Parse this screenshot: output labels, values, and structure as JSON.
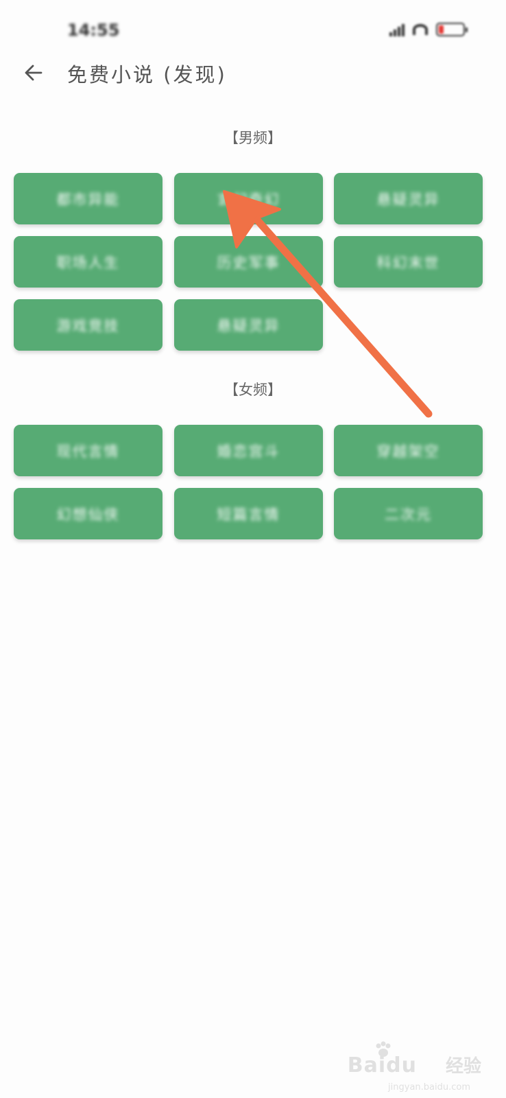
{
  "status_bar": {
    "time": "14:55",
    "icons": [
      "signal-icon",
      "wifi-icon",
      "battery-icon"
    ],
    "battery_color": "#e53935"
  },
  "header": {
    "back_icon": "arrow-left-icon",
    "title": "免费小说 (发现)"
  },
  "sections": [
    {
      "title": "【男频】",
      "categories": [
        {
          "label": "都市异能"
        },
        {
          "label": "玄幻奇幻"
        },
        {
          "label": "悬疑灵异"
        },
        {
          "label": "职场人生"
        },
        {
          "label": "历史军事"
        },
        {
          "label": "科幻末世"
        },
        {
          "label": "游戏竞技"
        },
        {
          "label": "悬疑灵异"
        }
      ]
    },
    {
      "title": "【女频】",
      "categories": [
        {
          "label": "现代言情"
        },
        {
          "label": "婚恋宫斗"
        },
        {
          "label": "穿越架空"
        },
        {
          "label": "幻想仙侠"
        },
        {
          "label": "短篇言情"
        },
        {
          "label": "二次元"
        }
      ]
    }
  ],
  "annotation": {
    "type": "arrow",
    "color": "#f07146",
    "points_to": "玄幻奇幻"
  },
  "watermark": {
    "logo": "Baidu",
    "cn": "经验",
    "url": "jingyan.baidu.com"
  },
  "colors": {
    "button_green": "#57ab74",
    "title_gray": "#555555",
    "background": "#fdfdfd"
  }
}
